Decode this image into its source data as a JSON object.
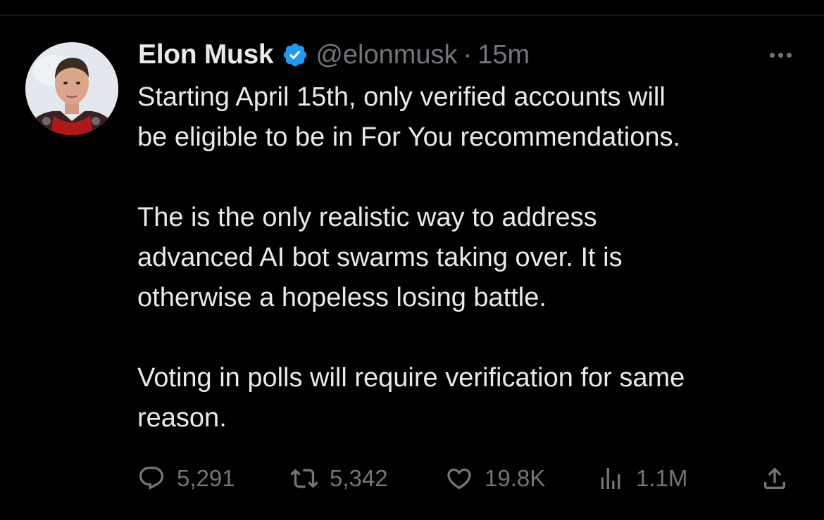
{
  "author": {
    "name": "Elon Musk",
    "handle": "@elonmusk",
    "separator": "·",
    "time": "15m"
  },
  "tweet": {
    "paragraphs": [
      "Starting April 15th, only verified accounts will\nbe eligible to be in For You recommendations.",
      "The is the only realistic way to address\nadvanced AI bot swarms taking over. It is\notherwise a hopeless losing battle.",
      "Voting in polls will require verification for same\nreason."
    ]
  },
  "actions": {
    "replies": "5,291",
    "retweets": "5,342",
    "likes": "19.8K",
    "views": "1.1M"
  },
  "icons": {
    "verified": "verified-badge-icon",
    "more": "more-dots-icon",
    "reply": "reply-icon",
    "retweet": "retweet-icon",
    "like": "heart-icon",
    "views": "views-icon",
    "share": "share-icon"
  },
  "colors": {
    "background": "#000000",
    "text": "#e7e9ea",
    "muted": "#71767b",
    "verified": "#1d9bf0",
    "divider": "#2f3336"
  }
}
